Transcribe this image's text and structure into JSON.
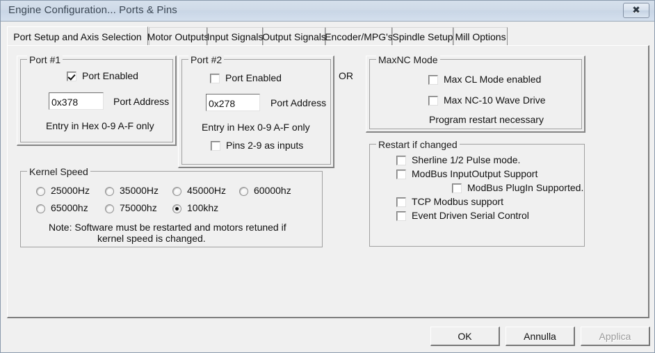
{
  "window": {
    "title": "Engine Configuration... Ports & Pins",
    "close_icon": "close-x-icon"
  },
  "tabs": [
    {
      "label": "Port Setup and Axis Selection",
      "selected": true
    },
    {
      "label": "Motor Outputs",
      "selected": false
    },
    {
      "label": "Input Signals",
      "selected": false
    },
    {
      "label": "Output Signals",
      "selected": false
    },
    {
      "label": "Encoder/MPG's",
      "selected": false
    },
    {
      "label": "Spindle Setup",
      "selected": false
    },
    {
      "label": "Mill Options",
      "selected": false
    }
  ],
  "port1": {
    "title": "Port #1",
    "enabled_label": "Port Enabled",
    "enabled_checked": true,
    "address_value": "0x378",
    "address_label": "Port Address",
    "hex_note": "Entry in Hex 0-9 A-F only"
  },
  "port2": {
    "title": "Port #2",
    "enabled_label": "Port Enabled",
    "enabled_checked": false,
    "address_value": "0x278",
    "address_label": "Port Address",
    "hex_note": "Entry in Hex 0-9 A-F only",
    "pins_label": "Pins 2-9 as inputs",
    "pins_checked": false
  },
  "or_label": "OR",
  "maxnc": {
    "title": "MaxNC Mode",
    "items": [
      {
        "label": "Max CL Mode enabled",
        "checked": false
      },
      {
        "label": "Max NC-10 Wave Drive",
        "checked": false
      }
    ],
    "note": "Program restart necessary"
  },
  "restart": {
    "title": "Restart if changed",
    "items": [
      {
        "label": "Sherline 1/2 Pulse mode.",
        "checked": false,
        "indent": false
      },
      {
        "label": "ModBus InputOutput Support",
        "checked": false,
        "indent": false
      },
      {
        "label": "ModBus PlugIn Supported.",
        "checked": false,
        "indent": true
      },
      {
        "label": "TCP Modbus support",
        "checked": false,
        "indent": false
      },
      {
        "label": "Event Driven Serial Control",
        "checked": false,
        "indent": false
      }
    ]
  },
  "kernel": {
    "title": "Kernel Speed",
    "options": [
      {
        "label": "25000Hz",
        "selected": false
      },
      {
        "label": "35000Hz",
        "selected": false
      },
      {
        "label": "45000Hz",
        "selected": false
      },
      {
        "label": "60000hz",
        "selected": false
      },
      {
        "label": "65000hz",
        "selected": false
      },
      {
        "label": "75000hz",
        "selected": false
      },
      {
        "label": "100khz",
        "selected": true
      }
    ],
    "note_line1": "Note: Software must be restarted and motors retuned if",
    "note_line2": "kernel speed is changed."
  },
  "footer": {
    "ok": "OK",
    "cancel": "Annulla",
    "apply": "Applica",
    "apply_disabled": true
  },
  "colors": {
    "window_bg": "#f0f0f0",
    "titlebar": "#cfdae8",
    "text": "#101010",
    "disabled_text": "#9a9a9a"
  }
}
